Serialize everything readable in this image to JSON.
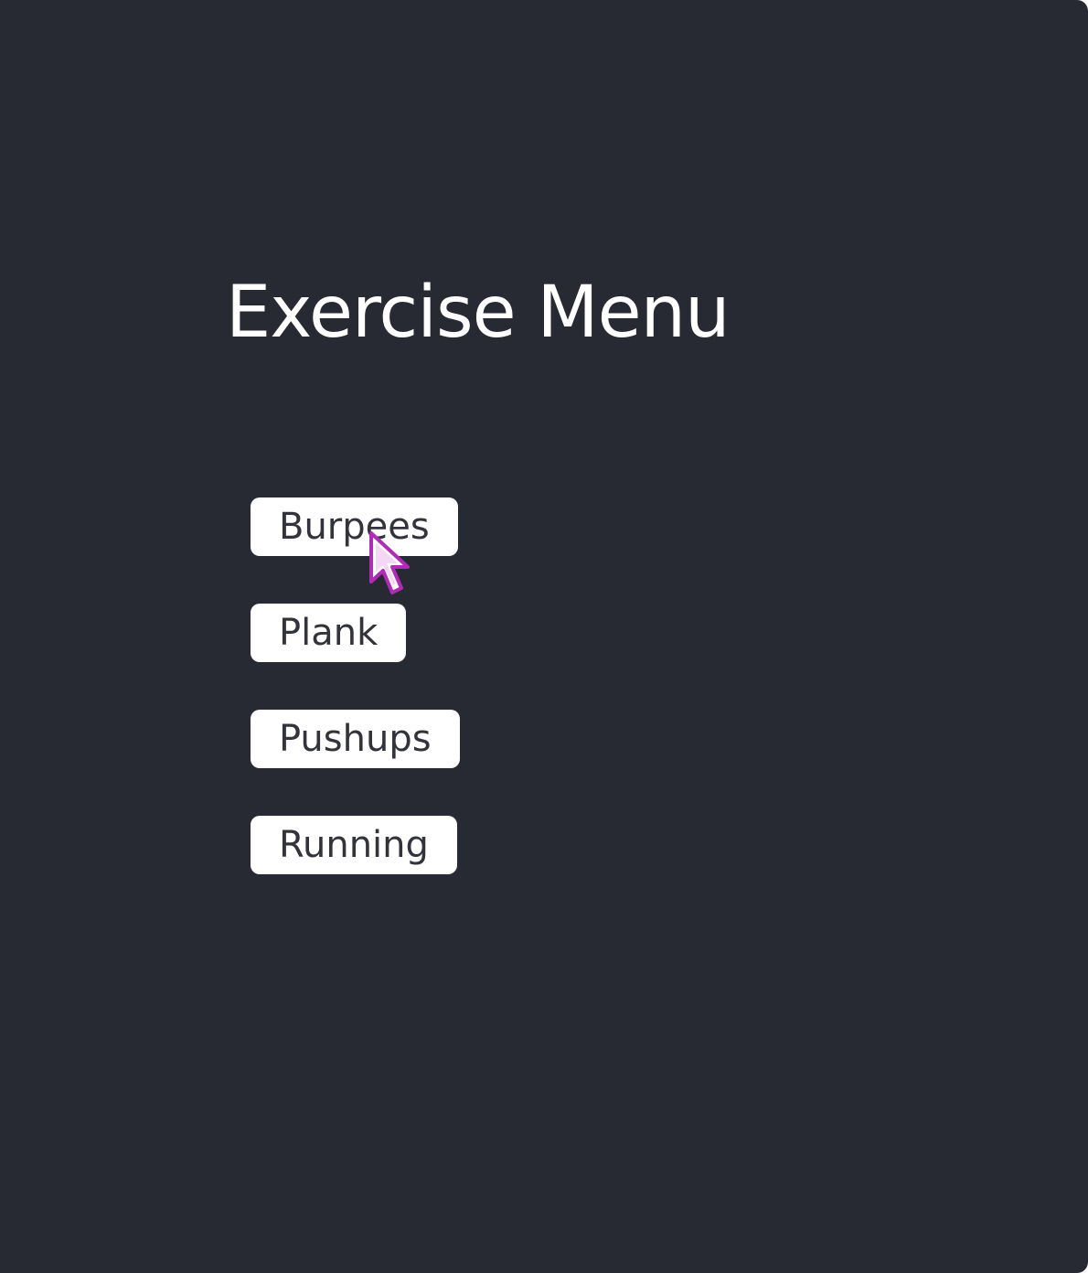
{
  "page": {
    "title": "Exercise Menu"
  },
  "menu": {
    "items": [
      {
        "label": "Burpees"
      },
      {
        "label": "Plank"
      },
      {
        "label": "Pushups"
      },
      {
        "label": "Running"
      }
    ]
  },
  "colors": {
    "background": "#282a33",
    "title_text": "#ffffff",
    "button_background": "#ffffff",
    "button_text": "#33343b",
    "cursor_accent": "#b22ab8"
  },
  "cursor": {
    "icon": "mouse-pointer-icon",
    "hovering": "Burpees"
  }
}
